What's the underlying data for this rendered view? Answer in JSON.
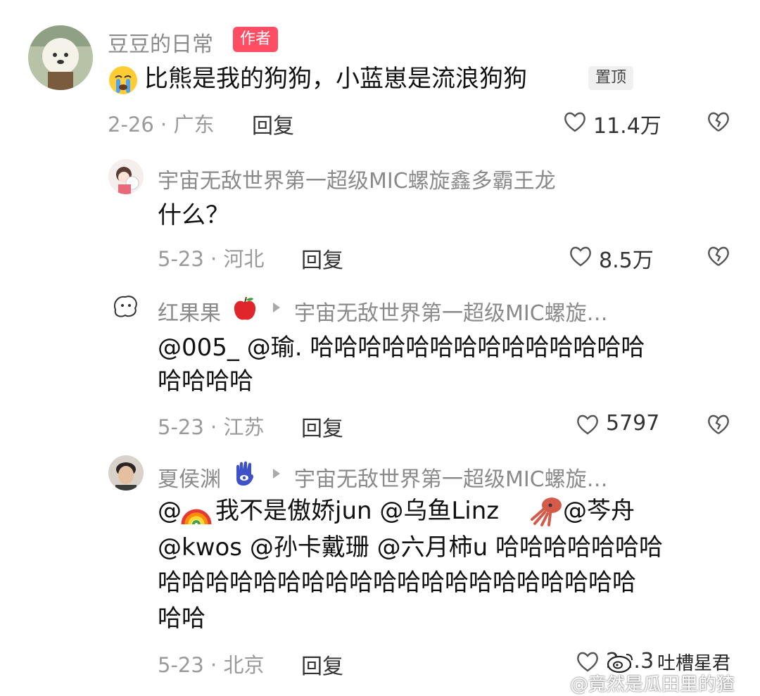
{
  "comments": [
    {
      "author": "豆豆的日常",
      "badge": "作者",
      "text": "比熊是我的狗狗，小蓝崽是流浪狗狗",
      "pin": "置顶",
      "meta": "2-26 · 广东",
      "reply": "回复",
      "likes": "11.4万"
    },
    {
      "author": "宇宙无敌世界第一超级MIC螺旋鑫多霸王龙",
      "text": "什么？",
      "meta": "5-23 · 河北",
      "reply": "回复",
      "likes": "8.5万"
    },
    {
      "author": "红果果",
      "reply_to": "宇宙无敌世界第一超级MIC螺旋…",
      "text_line1": "@005_ @瑜. 哈哈哈哈哈哈哈哈哈哈哈哈哈哈",
      "text_line2": "哈哈哈哈",
      "meta": "5-23 · 江苏",
      "reply": "回复",
      "likes": "5797"
    },
    {
      "author": "夏侯渊",
      "reply_to": "宇宙无敌世界第一超级MIC螺旋…",
      "text_line1a": "@",
      "text_line1b": "我不是傲娇jun @乌鱼Linz",
      "text_line1c": " @芩舟",
      "text_line2": "@kwos @孙卡戴珊 @六月柿u 哈哈哈哈哈哈哈",
      "text_line3": "哈哈哈哈哈哈哈哈哈哈哈哈哈哈哈哈哈哈哈哈",
      "text_line4": "哈哈",
      "meta": "5-23 · 北京",
      "reply": "回复",
      "likes": "2…3"
    }
  ],
  "watermark": {
    "line1": "吐槽星君",
    "line2": "@竟然是瓜田里的猹"
  },
  "icons": {
    "like": "heart-outline-icon",
    "dislike": "broken-heart-icon",
    "arrow": "reply-arrow-icon"
  }
}
